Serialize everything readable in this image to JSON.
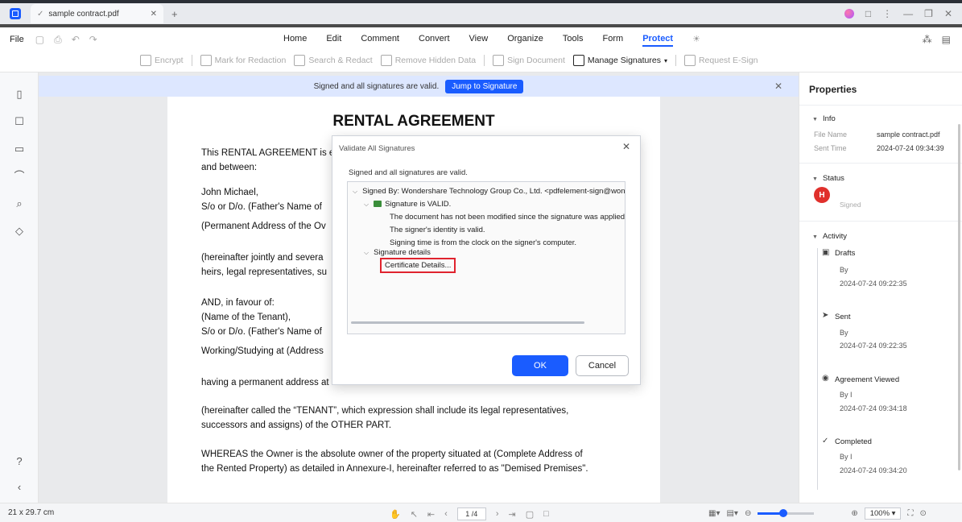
{
  "tab": {
    "title": "sample contract.pdf"
  },
  "menu": {
    "file": "File",
    "items": [
      "Home",
      "Edit",
      "Comment",
      "Convert",
      "View",
      "Organize",
      "Tools",
      "Form",
      "Protect"
    ],
    "active": "Protect"
  },
  "ribbon": {
    "encrypt": "Encrypt",
    "mark_redaction": "Mark for Redaction",
    "search_redact": "Search & Redact",
    "remove_hidden": "Remove Hidden Data",
    "sign_document": "Sign Document",
    "manage_signatures": "Manage Signatures",
    "request_esign": "Request E-Sign"
  },
  "notify": {
    "message": "Signed and all signatures are valid.",
    "jump": "Jump to Signature"
  },
  "document": {
    "title": "RENTAL AGREEMENT",
    "lines": [
      "This RENTAL AGREEMENT is e",
      "and between:",
      "John Michael,",
      "S/o or D/o. (Father's Name of",
      "(Permanent Address of the Ov",
      "(hereinafter jointly and severa",
      "heirs, legal representatives, su",
      "AND, in favour of:",
      "(Name of the Tenant),",
      "S/o or D/o. (Father's Name of",
      "Working/Studying at (Address",
      "having a permanent address at Littleroot Town",
      "(hereinafter called the “TENANT”, which expression shall include its legal representatives,",
      "successors and assigns) of the OTHER PART.",
      "WHEREAS the Owner is the absolute owner of the property situated at (Complete Address of",
      "the Rented Property) as detailed in Annexure-I, hereinafter referred to as \"Demised Premises\"."
    ]
  },
  "dialog": {
    "title": "Validate All Signatures",
    "message": "Signed and all signatures are valid.",
    "signed_by": "Signed By: Wondershare Technology Group Co., Ltd. <pdfelement-sign@wonde",
    "sig_valid": "Signature is VALID.",
    "detail1": "The document has not been modified since the signature was applied.",
    "detail2": "The signer's identity is valid.",
    "detail3": "Signing time is from the clock on the signer's computer.",
    "sig_details": "Signature details",
    "cert_details": "Certificate Details...",
    "ok": "OK",
    "cancel": "Cancel"
  },
  "properties": {
    "title": "Properties",
    "info_label": "Info",
    "file_name_key": "File Name",
    "file_name": "sample contract.pdf",
    "sent_time_key": "Sent Time",
    "sent_time": "2024-07-24 09:34:39",
    "status_label": "Status",
    "avatar_letter": "H",
    "status_text": "Signed",
    "activity_label": "Activity",
    "activities": [
      {
        "name": "Drafts",
        "by": "By",
        "time": "2024-07-24 09:22:35"
      },
      {
        "name": "Sent",
        "by": "By",
        "time": "2024-07-24 09:22:35"
      },
      {
        "name": "Agreement Viewed",
        "by": "By I",
        "time": "2024-07-24 09:34:18"
      },
      {
        "name": "Completed",
        "by": "By I",
        "time": "2024-07-24 09:34:20"
      }
    ]
  },
  "statusbar": {
    "page_size": "21 x 29.7 cm",
    "page_indicator": "1 /4",
    "zoom": "100%",
    "zoom_fraction": 0.45
  },
  "colors": {
    "accent": "#1a5cff",
    "highlight": "#e0232e",
    "avatar": "#e0302c"
  }
}
